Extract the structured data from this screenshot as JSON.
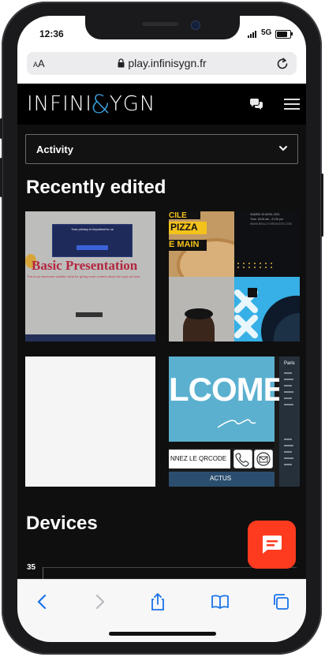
{
  "status": {
    "time": "12:36",
    "network": "5G"
  },
  "browser": {
    "aa_label_big": "A",
    "aa_label_small": "A",
    "url": "play.infinisygn.fr"
  },
  "header": {
    "logo_left": "INFINI",
    "logo_amp": "&",
    "logo_right": "YGN"
  },
  "filter": {
    "selected": "Activity"
  },
  "sections": {
    "recent_title": "Recently edited",
    "devices_title": "Devices"
  },
  "cards": [
    {
      "title": "Basic Presentation",
      "subtitle": "This is an awesome subtitle, ideal for giving more context about the topic at hand.",
      "modal_title": "Your privacy is important to us"
    },
    {
      "texts": [
        "CILE",
        "PIZZA",
        "E MAIN"
      ],
      "date": "SAMEDI 15 AVRIL 2021",
      "event_time": "Time: 18:00 am - 21:00 pm",
      "site": "WWW.REALLYGREATSITE.COM"
    },
    {},
    {
      "welcome": "LCOME",
      "qr": "NNEZ LE QRCODE",
      "news": "ACTUS",
      "side_label": "Paris"
    }
  ],
  "chart": {
    "y_max_label": "35"
  },
  "colors": {
    "accent": "#ff3b1f",
    "logo_blue": "#3aa4e0",
    "ios_blue": "#1a73e8"
  },
  "icons": [
    "chat-icon",
    "menu-icon",
    "chevron-down-icon",
    "lock-icon",
    "reload-icon",
    "back-icon",
    "forward-icon",
    "share-icon",
    "bookmarks-icon",
    "tabs-icon",
    "support-chat-icon"
  ]
}
